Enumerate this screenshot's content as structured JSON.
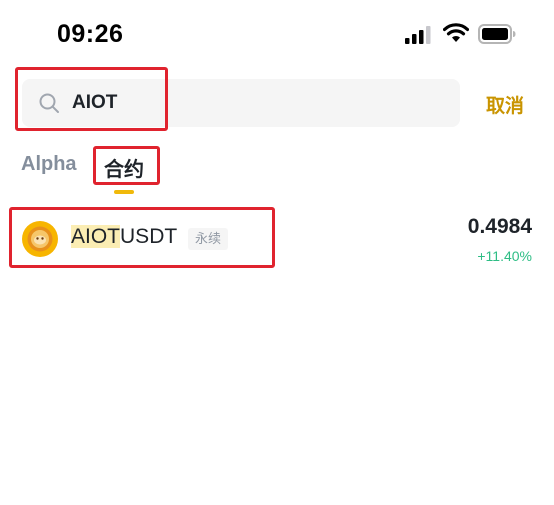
{
  "status_bar": {
    "time": "09:26",
    "icons": [
      "signal-icon",
      "wifi-icon",
      "battery-icon"
    ]
  },
  "search": {
    "value": "AIOT",
    "icon": "search-icon",
    "cancel_label": "取消"
  },
  "tabs": [
    {
      "label": "Alpha",
      "active": false
    },
    {
      "label": "合约",
      "active": true
    }
  ],
  "results": [
    {
      "pair_highlight": "AIOT",
      "pair_rest": "USDT",
      "badge": "永续",
      "price": "0.4984",
      "change": "+11.40%",
      "icon": "aiot-coin-icon"
    }
  ],
  "colors": {
    "accent": "#f0b90b",
    "cancel": "#c99400",
    "positive": "#2ebd85",
    "highlight": "#fbedb3",
    "annotation_box": "#e0232e"
  }
}
